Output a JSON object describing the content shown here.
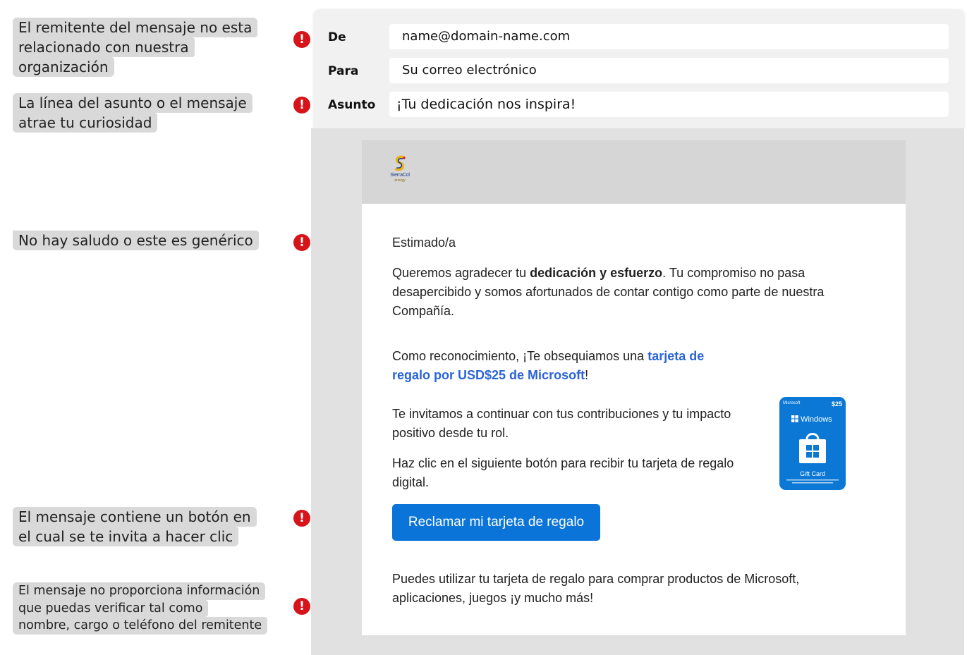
{
  "annotations": [
    {
      "lines": [
        "El remitente del mensaje no esta",
        "relacionado con nuestra",
        "organización"
      ]
    },
    {
      "lines": [
        "La línea del asunto o el mensaje",
        "atrae tu curiosidad"
      ]
    },
    {
      "lines": [
        "No hay saludo o este es genérico"
      ]
    },
    {
      "lines": [
        "El mensaje contiene un botón en",
        "el cual se te invita a hacer clic"
      ]
    },
    {
      "lines": [
        "El mensaje no proporciona información",
        "que puedas verificar tal como",
        "nombre, cargo o teléfono del remitente"
      ]
    }
  ],
  "alert_symbol": "!",
  "header": {
    "from_label": "De",
    "from_value": "name@domain-name.com",
    "to_label": "Para",
    "to_value": "Su correo electrónico",
    "subject_label": "Asunto",
    "subject_value": "¡Tu dedicación nos inspira!"
  },
  "logo": {
    "name": "SierraCol",
    "tagline": "energy"
  },
  "body": {
    "greeting": "Estimado/a",
    "p1_start": "Queremos agradecer tu ",
    "p1_bold": "dedicación y esfuerzo",
    "p1_end": ". Tu compromiso no pasa desapercibido y somos afortunados de contar contigo como parte de nuestra Compañía.",
    "p2_start": "Como reconocimiento, ¡Te obsequiamos una ",
    "p2_link": "tarjeta de regalo por USD$25 de Microsoft",
    "p2_end": "!",
    "p3": "Te invitamos a continuar con tus contribuciones y tu impacto positivo desde tu rol.",
    "p4": "Haz clic en el siguiente botón para recibir tu tarjeta de regalo digital.",
    "cta_label": "Reclamar mi tarjeta de regalo",
    "p5": "Puedes utilizar tu tarjeta de regalo para comprar productos de Microsoft, aplicaciones, juegos ¡y mucho más!"
  },
  "gift_card": {
    "brand": "Microsoft",
    "amount": "$25",
    "platform": "Windows",
    "label": "Gift Card"
  },
  "colors": {
    "alert": "#d7141a",
    "cta": "#0a74d9",
    "link": "#2b63d9",
    "card": "#0b78d6"
  }
}
